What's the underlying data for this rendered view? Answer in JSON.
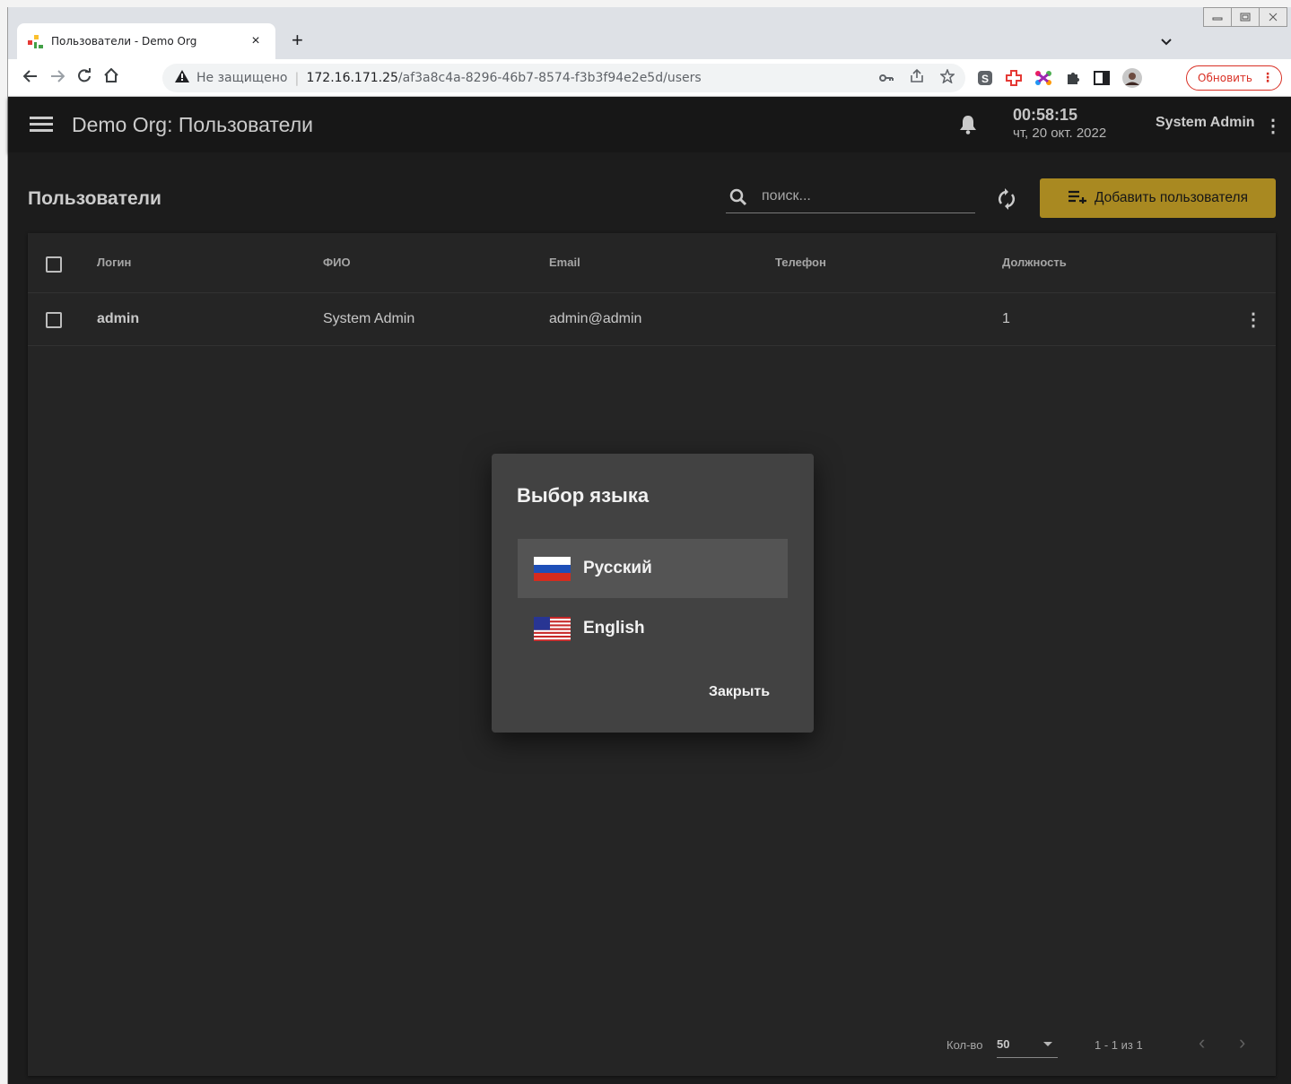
{
  "browser": {
    "tab_title": "Пользователи - Demo Org",
    "tab_close": "×",
    "new_tab": "+",
    "insecure_label": "Не защищено",
    "url_host": "172.16.171.25",
    "url_path": "/af3a8c4a-8296-46b7-8574-f3b3f94e2e5d/users",
    "update_label": "Обновить",
    "update_more": "⋮"
  },
  "app": {
    "title": "Demo Org: Пользователи",
    "time": "00:58:15",
    "date": "чт, 20 окт. 2022",
    "user_name": "System Admin",
    "user_more": "⋮"
  },
  "page": {
    "title": "Пользователи",
    "search_placeholder": "поиск...",
    "add_user_label": "Добавить пользователя"
  },
  "table": {
    "columns": [
      "Логин",
      "ФИО",
      "Email",
      "Телефон",
      "Должность"
    ],
    "rows": [
      {
        "login": "admin",
        "name": "System Admin",
        "email": "admin@admin",
        "phone": "",
        "position": "1",
        "more": "⋮"
      }
    ]
  },
  "footer": {
    "rows_label": "Кол-во",
    "rows_value": "50",
    "range": "1 - 1 из 1",
    "prev": "‹",
    "next": "›"
  },
  "dialog": {
    "title": "Выбор языка",
    "languages": [
      {
        "label": "Русский",
        "icon": "ru-flag-icon",
        "selected": true
      },
      {
        "label": "English",
        "icon": "us-flag-icon",
        "selected": false
      }
    ],
    "close_label": "Закрыть"
  },
  "colors": {
    "accent": "#c19d26",
    "app_background": "#202020",
    "dialog_background": "#424242",
    "update_red": "#d93025"
  }
}
